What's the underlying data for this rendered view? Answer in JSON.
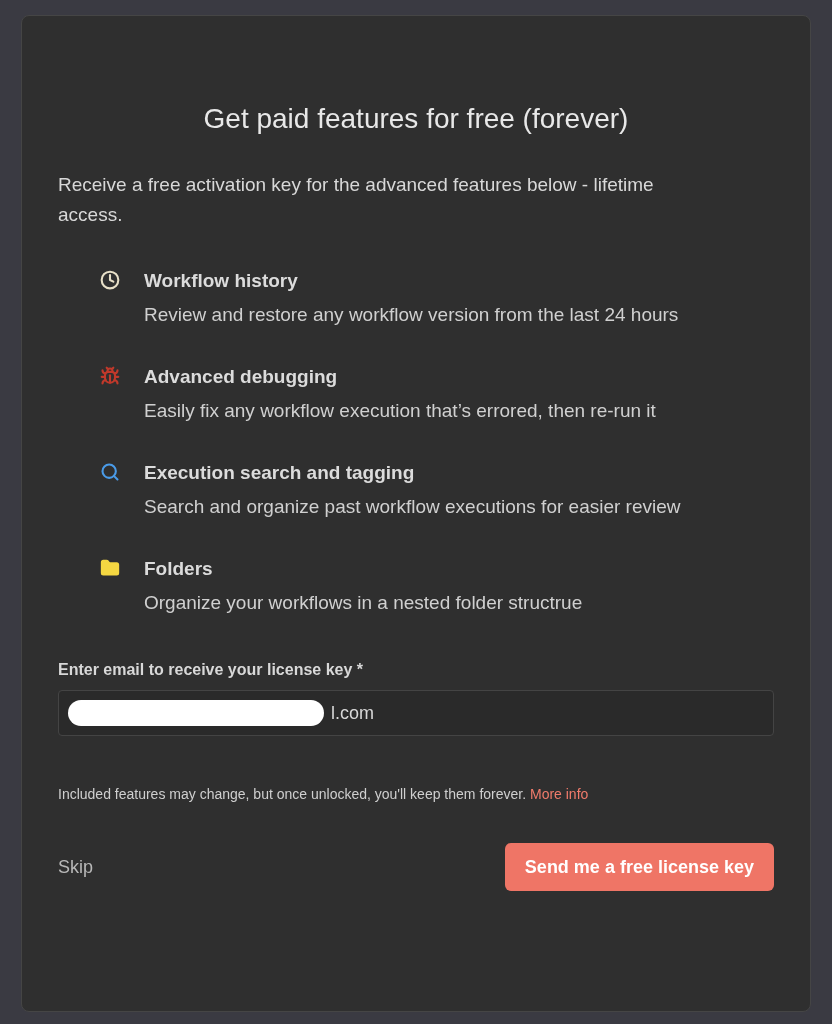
{
  "modal": {
    "title": "Get paid features for free (forever)",
    "intro": "Receive a free activation key for the advanced features below - lifetime access.",
    "features": [
      {
        "kind": "clock",
        "title": "Workflow history",
        "description": "Review and restore any workflow version from the last 24 hours"
      },
      {
        "kind": "bug",
        "title": "Advanced debugging",
        "description": "Easily fix any workflow execution that’s errored, then re-run it"
      },
      {
        "kind": "search",
        "title": "Execution search and tagging",
        "description": "Search and organize past workflow executions for easier review"
      },
      {
        "kind": "folder",
        "title": "Folders",
        "description": "Organize your workflows in a nested folder structrue"
      }
    ],
    "email_field": {
      "label": "Enter email to receive your license key *",
      "value": "l.com"
    },
    "note": "Included features may change, but once unlocked, you'll keep them forever.",
    "more_info_link": "More info",
    "skip_button": "Skip",
    "submit_button": "Send me a free license key"
  }
}
